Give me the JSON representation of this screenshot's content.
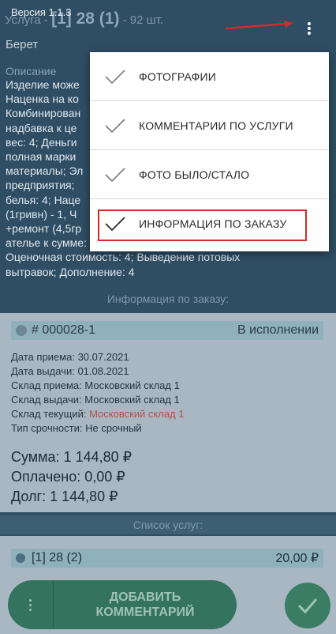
{
  "header": {
    "version": "Версия 1.1.3",
    "service_prefix": "Услуга -",
    "service_number": "[1] 28 (1)",
    "service_qty": "- 92 шт."
  },
  "item_name": "Берет",
  "description": {
    "label": "Описание",
    "lines": [
      "Изделие може",
      "Наценка на ко",
      "Комбинирован",
      "надбавка к це",
      "вес: 4; Деньги",
      "полная марки",
      "материалы; Эл",
      "предприятия; ",
      "белья: 4; Наце",
      "(1гривн) - 1, Ч",
      "+ремонт (4,5гр",
      "ателье к сумме: Подшить края рукавов, Озонирование,",
      "Оценочная стоимость: 4; Выведение потовых",
      "вытравок; Дополнение: 4"
    ]
  },
  "order_info": {
    "section_label": "Информация по заказу:",
    "number": "# 000028-1",
    "status": "В исполнении",
    "fields": [
      {
        "key": "Дата приема:",
        "value": "30.07.2021"
      },
      {
        "key": "Дата выдачи:",
        "value": "01.08.2021"
      },
      {
        "key": "Склад приема:",
        "value": "Московский склад 1"
      },
      {
        "key": "Склад выдачи:",
        "value": "Московский склад 1"
      },
      {
        "key": "Склад текущий:",
        "value": "Московский склад 1"
      },
      {
        "key": "Тип срочности:",
        "value": "Не срочный"
      }
    ],
    "sum": "Сумма: 1 144,80 ₽",
    "paid": "Оплачено: 0,00 ₽",
    "debt": "Долг: 1 144,80 ₽",
    "current_store_color": "#b0524f"
  },
  "services": {
    "section_label": "Список услуг:",
    "items": [
      {
        "name": "[1] 28 (2)",
        "price": "20,00 ₽"
      }
    ]
  },
  "bottom_bar": {
    "add_comment_line1": "ДОБАВИТЬ",
    "add_comment_line2": "КОММЕНТАРИЙ"
  },
  "menu": {
    "items": [
      {
        "label": "ФОТОГРАФИИ",
        "checked": true
      },
      {
        "label": "КОММЕНТАРИИ ПО УСЛУГИ",
        "checked": true
      },
      {
        "label": "ФОТО БЫЛО/СТАЛО",
        "checked": true
      },
      {
        "label": "ИНФОРМАЦИЯ ПО ЗАКАЗУ",
        "checked": true
      }
    ]
  },
  "colors": {
    "background": "#2f4d63",
    "accent_green": "#34735e",
    "annotation_red": "#d22b2b"
  }
}
